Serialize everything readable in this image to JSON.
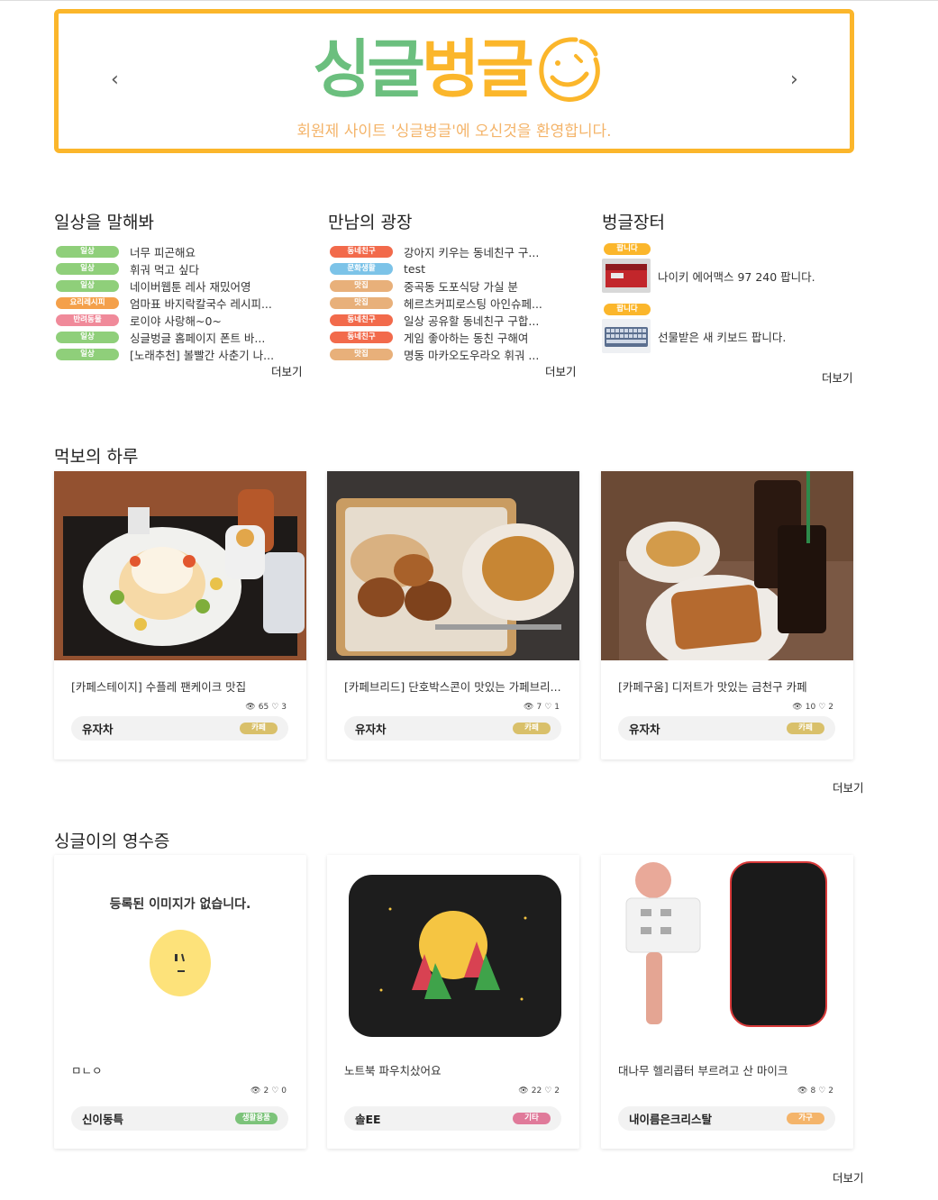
{
  "banner": {
    "logo_part1": "싱글",
    "logo_part2": "벙글",
    "tagline": "회원제 사이트 '싱글벙글'에 오신것을 환영합니다.",
    "prev_icon": "‹",
    "next_icon": "›"
  },
  "colors": {
    "accent_orange": "#fbb62b",
    "accent_green": "#6bbf7e"
  },
  "boards": [
    {
      "title": "일상을 말해봐",
      "more": "더보기",
      "posts": [
        {
          "tag": "일상",
          "tag_color": "#8fcf7a",
          "title": "너무 피곤해요"
        },
        {
          "tag": "일상",
          "tag_color": "#8fcf7a",
          "title": "휘궈 먹고 싶다"
        },
        {
          "tag": "일상",
          "tag_color": "#8fcf7a",
          "title": "네이버웹툰 레사 재밌어영"
        },
        {
          "tag": "요리레시피",
          "tag_color": "#f4a04a",
          "title": "엄마표 바지락칼국수 레시피..."
        },
        {
          "tag": "반려동물",
          "tag_color": "#f08a9a",
          "title": "로이야 사랑해~0~"
        },
        {
          "tag": "일상",
          "tag_color": "#8fcf7a",
          "title": "싱글벙글 홈페이지 폰트 바..."
        },
        {
          "tag": "일상",
          "tag_color": "#8fcf7a",
          "title": "[노래추천] 볼빨간 사춘기 나..."
        }
      ]
    },
    {
      "title": "만남의 광장",
      "more": "더보기",
      "posts": [
        {
          "tag": "동네친구",
          "tag_color": "#f26a4b",
          "title": "강아지 키우는 동네친구 구..."
        },
        {
          "tag": "문화생활",
          "tag_color": "#7cc3e8",
          "title": "test"
        },
        {
          "tag": "맛집",
          "tag_color": "#e8b07a",
          "title": "중곡동 도포식당 가실 분"
        },
        {
          "tag": "맛집",
          "tag_color": "#e8b07a",
          "title": "헤르츠커피로스팅 아인슈페..."
        },
        {
          "tag": "동네친구",
          "tag_color": "#f26a4b",
          "title": "일상 공유할 동네친구 구합..."
        },
        {
          "tag": "동네친구",
          "tag_color": "#f26a4b",
          "title": "게임 좋아하는 동친 구해여"
        },
        {
          "tag": "맛집",
          "tag_color": "#e8b07a",
          "title": "명동 마카오도우라오 휘궈 ..."
        }
      ]
    },
    {
      "title": "벙글장터",
      "more": "더보기",
      "items": [
        {
          "tag": "팝니다",
          "tag_color": "#fbb62b",
          "title": "나이키 에어맥스 97 240 팝니다.",
          "thumb": "shoebox"
        },
        {
          "tag": "팝니다",
          "tag_color": "#fbb62b",
          "title": "선물받은 새 키보드 팝니다.",
          "thumb": "keyboard"
        }
      ]
    }
  ],
  "food": {
    "title": "먹보의 하루",
    "more": "더보기",
    "cards": [
      {
        "title": "[카페스테이지] 수플레 팬케이크 맛집",
        "views": "65",
        "likes": "3",
        "author": "유자차",
        "category": "카페",
        "cat_color": "#d9c06a",
        "photo": "pancake"
      },
      {
        "title": "[카페브리드] 단호박스콘이 맛있는 가페브리...",
        "views": "7",
        "likes": "1",
        "author": "유자차",
        "category": "카페",
        "cat_color": "#d9c06a",
        "photo": "scone"
      },
      {
        "title": "[카페구움] 디저트가 맛있는 금천구 카페",
        "views": "10",
        "likes": "2",
        "author": "유자차",
        "category": "카페",
        "cat_color": "#d9c06a",
        "photo": "waffle"
      }
    ]
  },
  "receipts": {
    "title": "싱글이의 영수증",
    "more": "더보기",
    "no_image_text": "등록된 이미지가 없습니다.",
    "cards": [
      {
        "title": "ㅁㄴㅇ",
        "views": "2",
        "likes": "0",
        "author": "신이동특",
        "category": "생활용품",
        "cat_color": "#7cc37a",
        "photo": "noimage"
      },
      {
        "title": "노트북 파우치샀어요",
        "views": "22",
        "likes": "2",
        "author": "솔EE",
        "category": "기타",
        "cat_color": "#e07a9a",
        "photo": "pouch"
      },
      {
        "title": "대나무 헬리콥터 부르려고 산 마이크",
        "views": "8",
        "likes": "2",
        "author": "내이름은크리스탈",
        "category": "가구",
        "cat_color": "#f4b46a",
        "photo": "mic"
      }
    ]
  }
}
